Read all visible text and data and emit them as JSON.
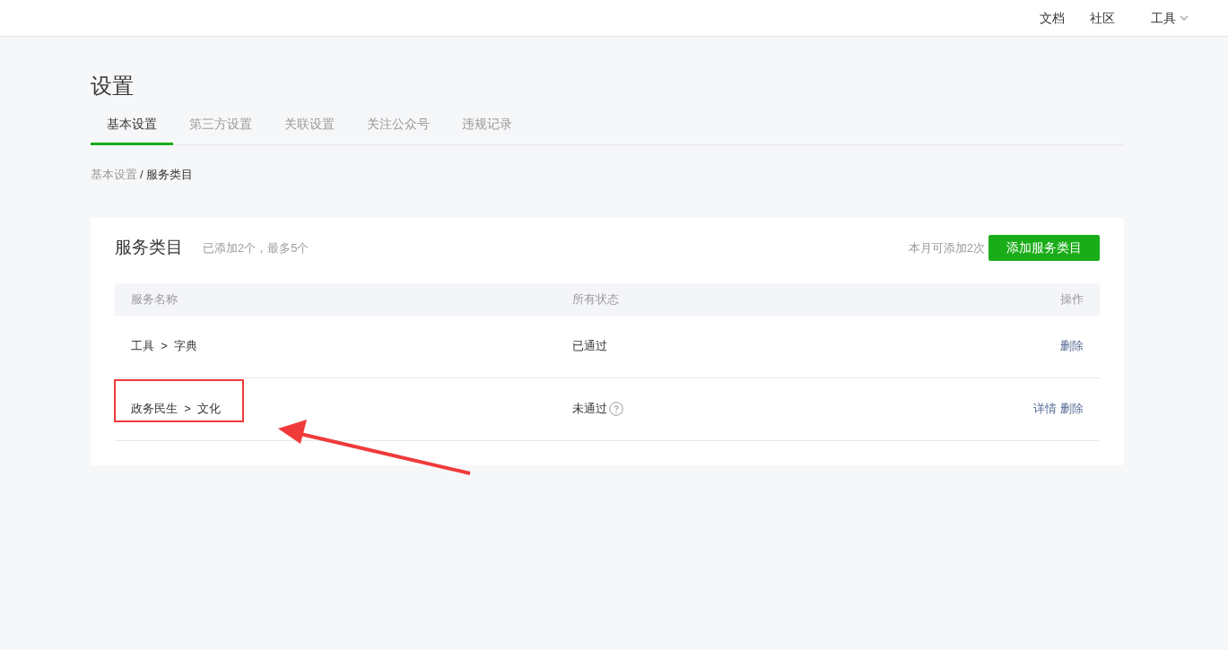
{
  "top_nav": [
    {
      "label": "文档",
      "has_caret": false
    },
    {
      "label": "社区",
      "has_caret": false
    },
    {
      "label": "工具",
      "has_caret": true
    }
  ],
  "page_title": "设置",
  "tabs": [
    {
      "label": "基本设置",
      "selected": true
    },
    {
      "label": "第三方设置",
      "selected": false
    },
    {
      "label": "关联设置",
      "selected": false
    },
    {
      "label": "关注公众号",
      "selected": false
    },
    {
      "label": "违规记录",
      "selected": false
    }
  ],
  "breadcrumb": [
    {
      "label": "基本设置",
      "current": false
    },
    {
      "label": "服务类目",
      "current": true
    }
  ],
  "breadcrumb_separator": "/",
  "card": {
    "title": "服务类目",
    "subtitle": "已添加2个，最多5个",
    "quota_note": "本月可添加2次",
    "add_button": "添加服务类目",
    "table": {
      "columns": [
        "服务名称",
        "所有状态",
        "操作"
      ],
      "rows": [
        {
          "name": [
            "工具",
            "字典"
          ],
          "status": "已通过",
          "help_icon": false,
          "actions": [
            "删除"
          ],
          "highlighted": false
        },
        {
          "name": [
            "政务民生",
            "文化"
          ],
          "status": "未通过",
          "help_icon": true,
          "actions": [
            "详情",
            "删除"
          ],
          "highlighted": true
        }
      ]
    },
    "name_separator": ">"
  }
}
